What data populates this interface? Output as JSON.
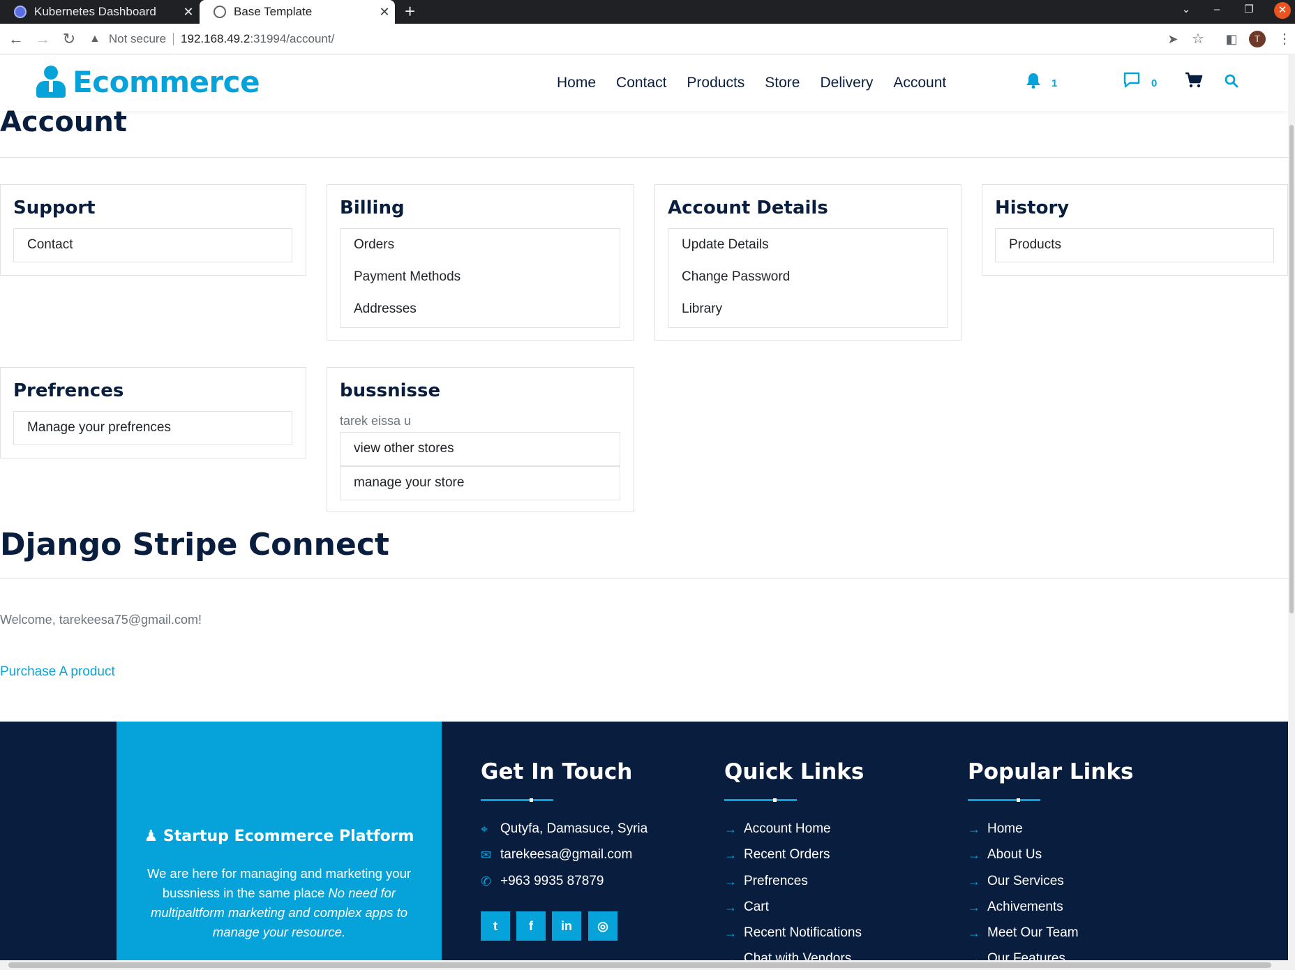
{
  "browser": {
    "tabs": [
      {
        "title": "Kubernetes Dashboard",
        "active": false
      },
      {
        "title": "Base Template",
        "active": true
      }
    ],
    "new_tab_icon": "plus-icon",
    "security_label": "Not secure",
    "url_host": "192.168.49.2",
    "url_path": ":31994/account/",
    "profile_initial": "T"
  },
  "header": {
    "brand": "Ecommerce",
    "nav": [
      "Home",
      "Contact",
      "Products",
      "Store",
      "Delivery",
      "Account"
    ],
    "notification_count": "1",
    "message_count": "0",
    "colors": {
      "accent": "#06a3da",
      "dark": "#091e3e"
    }
  },
  "page": {
    "title": "Account",
    "cards": {
      "support": {
        "title": "Support",
        "items": [
          "Contact"
        ]
      },
      "billing": {
        "title": "Billing",
        "items": [
          "Orders",
          "Payment Methods",
          "Addresses"
        ]
      },
      "account_details": {
        "title": "Account Details",
        "items": [
          "Update Details",
          "Change Password",
          "Library"
        ]
      },
      "history": {
        "title": "History",
        "items": [
          "Products"
        ]
      },
      "preferences": {
        "title": "Prefrences",
        "items": [
          "Manage your prefrences"
        ]
      },
      "business": {
        "title": "bussnisse",
        "owner": "tarek eissa u",
        "items": [
          "view other stores",
          "manage your store"
        ]
      }
    },
    "stripe": {
      "title": "Django Stripe Connect",
      "welcome": "Welcome, tarekeesa75@gmail.com!",
      "purchase_link": "Purchase A product"
    }
  },
  "footer": {
    "brand_line": "Startup Ecommerce Platform",
    "brand_desc_plain": "We are here for managing and marketing your bussniess in the same place ",
    "brand_desc_italic": "No need for multipaltform marketing and complex apps to manage your resource.",
    "get_in_touch": {
      "title": "Get In Touch",
      "address": "Qutyfa, Damasuce, Syria",
      "email": "tarekeesa@gmail.com",
      "phone": "+963 9935 87879"
    },
    "social": [
      "twitter-icon",
      "facebook-icon",
      "linkedin-icon",
      "instagram-icon"
    ],
    "quick_links": {
      "title": "Quick Links",
      "items": [
        "Account Home",
        "Recent Orders",
        "Prefrences",
        "Cart",
        "Recent Notifications",
        "Chat with Vendors"
      ]
    },
    "popular_links": {
      "title": "Popular Links",
      "items": [
        "Home",
        "About Us",
        "Our Services",
        "Achivements",
        "Meet Our Team",
        "Our Features"
      ]
    }
  }
}
